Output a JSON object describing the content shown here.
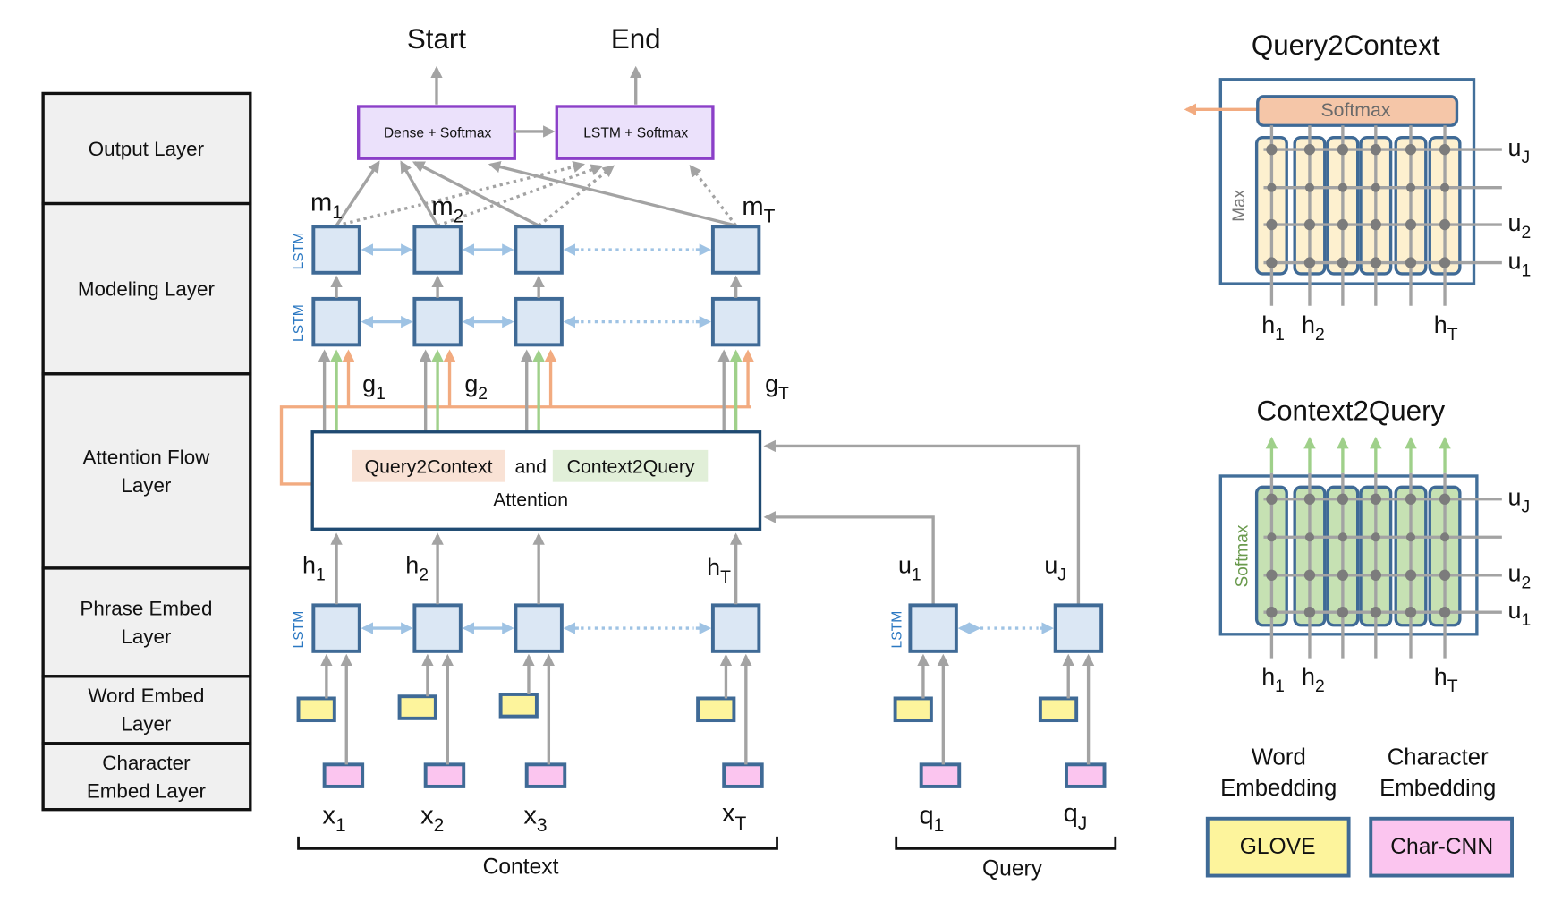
{
  "layers": [
    {
      "label_lines": [
        "Output  Layer"
      ]
    },
    {
      "label_lines": [
        "Modeling  Layer"
      ]
    },
    {
      "label_lines": [
        "Attention  Flow",
        "Layer"
      ]
    },
    {
      "label_lines": [
        "Phrase Embed",
        "Layer"
      ]
    },
    {
      "label_lines": [
        "Word Embed",
        "Layer"
      ]
    },
    {
      "label_lines": [
        "Character",
        "Embed Layer"
      ]
    }
  ],
  "outputs": {
    "start_label": "Start",
    "end_label": "End",
    "dense_box": "Dense  + Softmax",
    "lstm_box": "LSTM + Softmax"
  },
  "lstm_label": "LSTM",
  "modeling": {
    "m_labels": [
      {
        "base": "m",
        "sub": "1"
      },
      {
        "base": "m",
        "sub": "2"
      },
      {
        "base": "m",
        "sub": "T"
      }
    ]
  },
  "attention": {
    "q2c": "Query2Context",
    "and": "and",
    "c2q": "Context2Query",
    "line2": "Attention",
    "g_labels": [
      {
        "base": "g",
        "sub": "1"
      },
      {
        "base": "g",
        "sub": "2"
      },
      {
        "base": "g",
        "sub": "T"
      }
    ]
  },
  "phrase": {
    "h_labels": [
      {
        "base": "h",
        "sub": "1"
      },
      {
        "base": "h",
        "sub": "2"
      },
      {
        "base": "h",
        "sub": "T"
      }
    ],
    "u_labels": [
      {
        "base": "u",
        "sub": "1"
      },
      {
        "base": "u",
        "sub": "J"
      }
    ]
  },
  "inputs": {
    "context_tokens": [
      {
        "base": "x",
        "sub": "1"
      },
      {
        "base": "x",
        "sub": "2"
      },
      {
        "base": "x",
        "sub": "3"
      },
      {
        "base": "x",
        "sub": "T"
      }
    ],
    "query_tokens": [
      {
        "base": "q",
        "sub": "1"
      },
      {
        "base": "q",
        "sub": "J"
      }
    ],
    "context_label": "Context",
    "query_label": "Query"
  },
  "q2c_panel": {
    "title": "Query2Context",
    "softmax": "Softmax",
    "side_label": "Max",
    "u_labels": [
      {
        "base": "u",
        "sub": "J"
      },
      {
        "base": "u",
        "sub": "2"
      },
      {
        "base": "u",
        "sub": "1"
      }
    ],
    "h_labels": [
      {
        "base": "h",
        "sub": "1"
      },
      {
        "base": "h",
        "sub": "2"
      },
      {
        "base": "h",
        "sub": "T"
      }
    ]
  },
  "c2q_panel": {
    "title": "Context2Query",
    "side_label": "Softmax",
    "u_labels": [
      {
        "base": "u",
        "sub": "J"
      },
      {
        "base": "u",
        "sub": "2"
      },
      {
        "base": "u",
        "sub": "1"
      }
    ],
    "h_labels": [
      {
        "base": "h",
        "sub": "1"
      },
      {
        "base": "h",
        "sub": "2"
      },
      {
        "base": "h",
        "sub": "T"
      }
    ]
  },
  "legend": {
    "word_title": [
      "Word",
      "Embedding"
    ],
    "char_title": [
      "Character",
      "Embedding"
    ],
    "word_box": "GLOVE",
    "char_box": "Char-CNN"
  },
  "colors": {
    "lstm_fill": "#dbe7f4",
    "lstm_stroke": "#3f6a96",
    "output_fill": "#ebe1fb",
    "output_stroke": "#8b3fc8",
    "q2c_highlight": "#f9e2d5",
    "c2q_highlight": "#e1efd8",
    "word_embedding": "#fdf49c",
    "char_embedding": "#fbc5ef",
    "orange_flow": "#f2ab80",
    "green_flow": "#9fd08a"
  }
}
